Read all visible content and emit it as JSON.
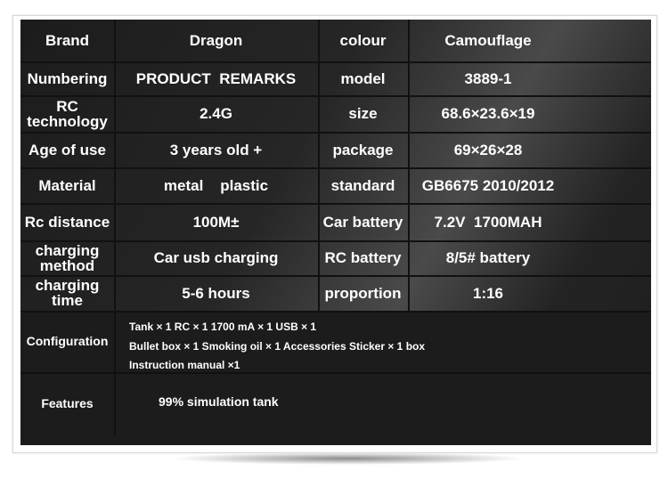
{
  "rows": [
    {
      "label": "Brand",
      "value": "Dragon",
      "label2": "colour",
      "value2": "Camouflage"
    },
    {
      "label": "Numbering",
      "value": "PRODUCT  REMARKS",
      "label2": "model",
      "value2": "3889-1"
    },
    {
      "label": "RC technology",
      "value": "2.4G",
      "label2": "size",
      "value2": "68.6×23.6×19"
    },
    {
      "label": "Age of use",
      "value": "3 years old +",
      "label2": "package",
      "value2": "69×26×28"
    },
    {
      "label": "Material",
      "value": "metal    plastic",
      "label2": "standard",
      "value2": "GB6675 2010/2012"
    },
    {
      "label": "Rc distance",
      "value": "100M±",
      "label2": "Car battery",
      "value2": "7.2V  1700MAH"
    },
    {
      "label": "charging method",
      "value": "Car usb charging",
      "label2": "RC battery",
      "value2": "8/5# battery"
    },
    {
      "label": "charging time",
      "value": "5-6 hours",
      "label2": "proportion",
      "value2": "1:16"
    }
  ],
  "configuration": {
    "label": "Configuration",
    "lines": [
      "Tank × 1 RC × 1 1700 mA × 1 USB × 1",
      "Bullet box × 1 Smoking oil × 1 Accessories Sticker × 1 box",
      "Instruction manual ×1"
    ]
  },
  "features": {
    "label": "Features",
    "value": "99% simulation tank"
  }
}
